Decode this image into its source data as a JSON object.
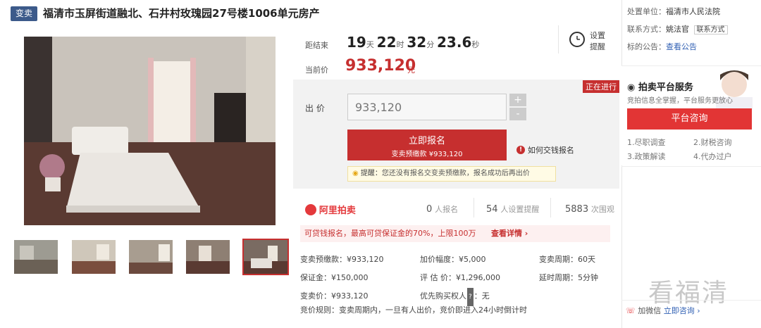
{
  "header": {
    "tag": "变卖",
    "title": "福清市玉屏街道融北、石井村玫瑰园27号楼1006单元房产"
  },
  "countdown": {
    "label": "距结束",
    "d": "19",
    "d_unit": "天",
    "h": "22",
    "h_unit": "时",
    "m": "32",
    "m_unit": "分",
    "s": "23.6",
    "s_unit": "秒",
    "remind_line1": "设置",
    "remind_line2": "提醒"
  },
  "price": {
    "label": "当前价",
    "value": "933,120",
    "unit": "元"
  },
  "bid": {
    "status": "正在进行",
    "label": "出 价",
    "input_value": "933,120",
    "plus": "+",
    "minus": "-",
    "signup_line1": "立即报名",
    "signup_line2": "变卖预缴款 ¥933,120",
    "how_link": "如何交钱报名",
    "tip_label": "提醒：",
    "tip_text": "您还没有报名交变卖预缴款，报名成功后再出价"
  },
  "platform": {
    "logo": "阿里拍卖",
    "signups_num": "0",
    "signups_lbl": "人报名",
    "reminders_num": "54",
    "reminders_lbl": "人设置提醒",
    "views_num": "5883",
    "views_lbl": "次围观"
  },
  "loan": {
    "text": "可贷钱报名，最高可贷保证金的70%，上限100万",
    "link": "查看详情 ›"
  },
  "details": [
    [
      "变卖预缴款：¥933,120",
      "加价幅度：¥5,000",
      "变卖周期：60天"
    ],
    [
      "保证金：¥150,000",
      "评 估 价：¥1,296,000",
      "延时周期：5分钟"
    ],
    [
      "变卖价：¥933,120",
      "优先购买权人",
      "：无"
    ]
  ],
  "rules": {
    "label": "竞价规则：",
    "text": "变卖周期内，一旦有人出价，竞价即进入24小时倒计时"
  },
  "right": {
    "court_label": "处置单位：",
    "court_value": "福清市人民法院",
    "contact_label": "联系方式：",
    "contact_value": "姚法官",
    "contact_btn": "联系方式",
    "notice_label": "标的公告：",
    "notice_link": "查看公告",
    "service_title": "拍卖平台服务",
    "service_sub": "竞拍信息全掌握，平台服务更放心",
    "consult_btn": "平台咨询",
    "items": [
      "1.尽职调查",
      "2.财税咨询",
      "3.政策解读",
      "4.代办过户"
    ],
    "watermark": "看福清",
    "bottom_text": "加微信 ",
    "bottom_link": "立即咨询 ›"
  }
}
